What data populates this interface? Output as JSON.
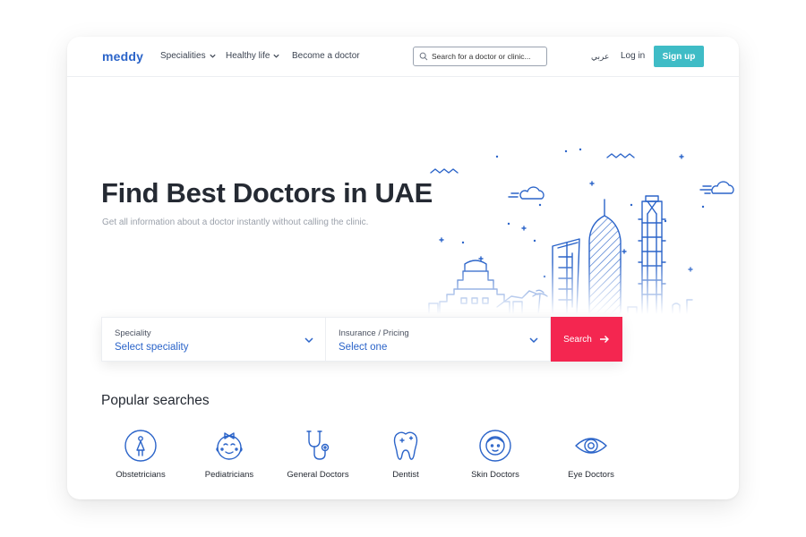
{
  "nav": {
    "logo": "meddy",
    "items": [
      "Specialities",
      "Healthy life",
      "Become a doctor"
    ],
    "search_placeholder": "Search for a doctor or clinic...",
    "lang": "عربي",
    "login": "Log in",
    "signup": "Sign up"
  },
  "hero": {
    "title": "Find Best Doctors in UAE",
    "subtitle": "Get all information about a doctor instantly without calling the clinic."
  },
  "search_form": {
    "speciality_label": "Speciality",
    "speciality_value": "Select speciality",
    "insurance_label": "Insurance / Pricing",
    "insurance_value": "Select one",
    "button": "Search"
  },
  "popular": {
    "title": "Popular searches",
    "items": [
      {
        "label": "Obstetricians",
        "icon": "obstetrician-icon"
      },
      {
        "label": "Pediatricians",
        "icon": "baby-face-icon"
      },
      {
        "label": "General Doctors",
        "icon": "stethoscope-icon"
      },
      {
        "label": "Dentist",
        "icon": "tooth-icon"
      },
      {
        "label": "Skin Doctors",
        "icon": "face-icon"
      },
      {
        "label": "Eye Doctors",
        "icon": "eye-icon"
      }
    ]
  },
  "colors": {
    "brand": "#2b64c9",
    "accent": "#f42650",
    "signup": "#3fbcc6"
  }
}
